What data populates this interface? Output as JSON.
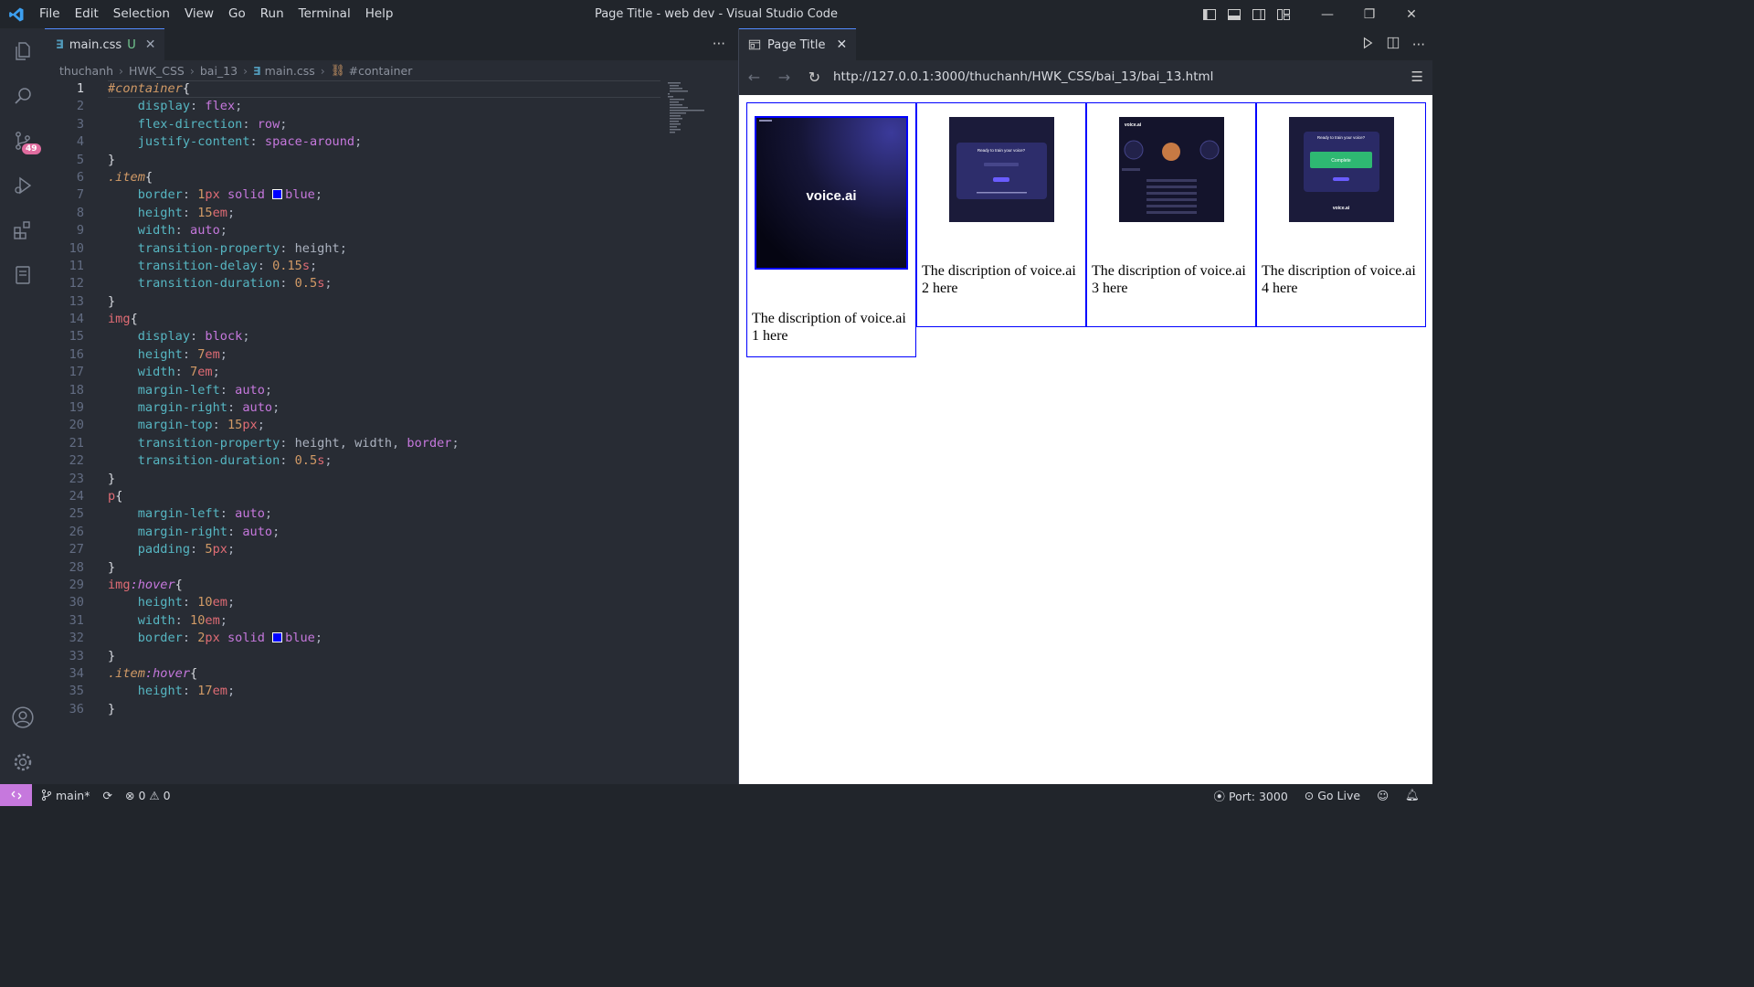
{
  "window": {
    "title": "Page Title - web dev - Visual Studio Code",
    "menu": [
      "File",
      "Edit",
      "Selection",
      "View",
      "Go",
      "Run",
      "Terminal",
      "Help"
    ]
  },
  "activity": {
    "scm_badge": "49"
  },
  "editor": {
    "tab": {
      "icon": "css-file-icon",
      "label": "main.css",
      "status": "U"
    },
    "breadcrumb": [
      "thuchanh",
      "HWK_CSS",
      "bai_13",
      "main.css",
      "#container"
    ]
  },
  "browser": {
    "tab_label": "Page Title",
    "url": "http://127.0.0.1:3000/thuchanh/HWK_CSS/bai_13/bai_13.html",
    "items": [
      {
        "caption": "The discription of voice.ai 1 here",
        "logo_text": "voice.ai"
      },
      {
        "caption": "The discription of voice.ai 2 here",
        "screen_text": "Ready to train your voice?"
      },
      {
        "caption": "The discription of voice.ai 3 here",
        "screen_text": "voice.ai"
      },
      {
        "caption": "The discription of voice.ai 4 here",
        "screen_text": "Ready to train your voice?",
        "button": "Complete",
        "footer": "voice.ai"
      }
    ]
  },
  "status": {
    "branch": "main*",
    "errors": "0",
    "warnings": "0",
    "port": "Port: 3000",
    "golive": "Go Live"
  },
  "colors": {
    "accent": "#528bff",
    "remote": "#c678dd",
    "badge": "#e06c9f",
    "border_blue": "#0000ff"
  }
}
